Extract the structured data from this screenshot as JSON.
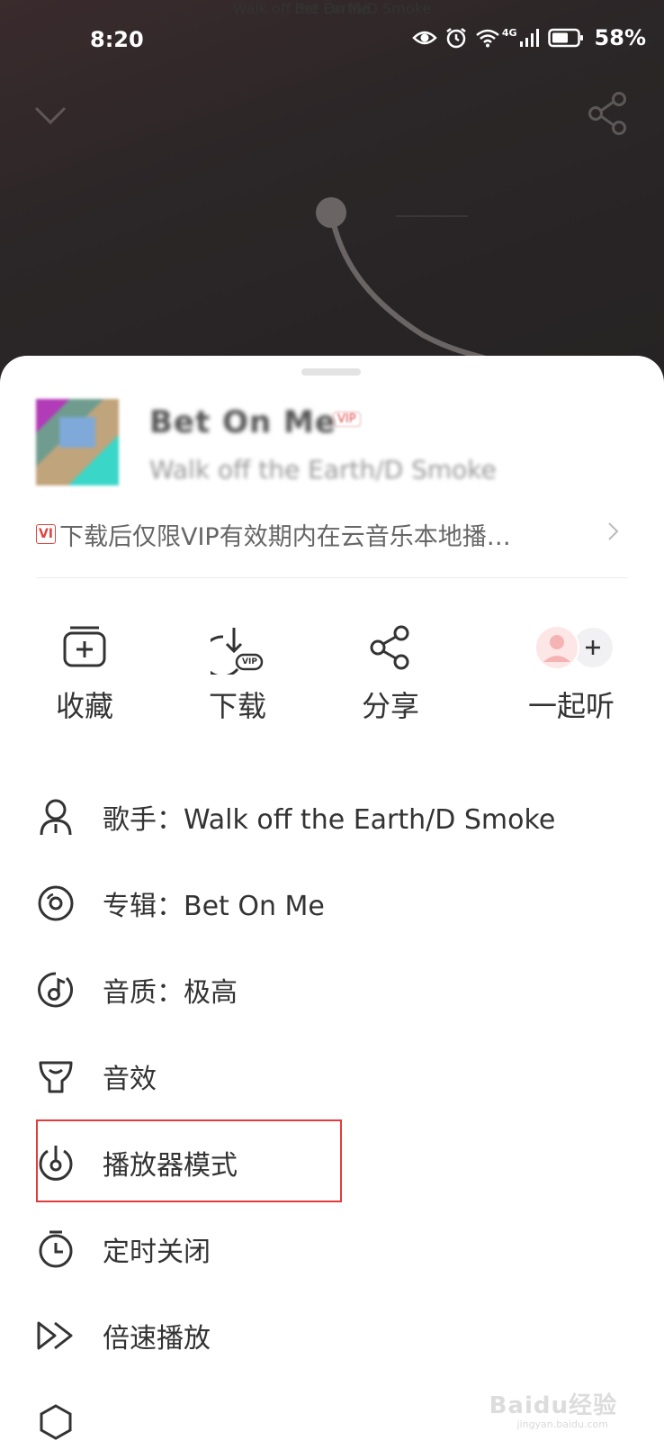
{
  "status_bar": {
    "time": "8:20",
    "network": "4G",
    "battery": "58%",
    "icons": [
      "eye-icon",
      "alarm-icon",
      "wifi-icon",
      "signal-icon",
      "battery-icon"
    ]
  },
  "player": {
    "song_title": "Bet On Me",
    "artist_line": "Walk off the Earth/D Smoke",
    "icons": [
      "chevron-down-icon",
      "share-icon"
    ]
  },
  "sheet": {
    "song_title": "Bet On Me",
    "vip_badge": "VIP",
    "artist": "Walk off the Earth/D Smoke",
    "notice_tag": "VI",
    "notice": "下载后仅限VIP有效期内在云音乐本地播…",
    "actions": [
      {
        "label": "收藏",
        "icon": "collect-icon"
      },
      {
        "label": "下载",
        "icon": "download-vip-icon"
      },
      {
        "label": "分享",
        "icon": "share-icon"
      },
      {
        "label": "一起听",
        "icon": "listen-together-icon"
      }
    ],
    "download_vip_tag": "VIP",
    "menu": [
      {
        "label": "歌手：Walk off the Earth/D Smoke",
        "icon": "singer-icon"
      },
      {
        "label": "专辑：Bet On Me",
        "icon": "album-icon"
      },
      {
        "label": "音质：极高",
        "icon": "quality-icon"
      },
      {
        "label": "音效",
        "icon": "sound-effect-icon"
      },
      {
        "label": "播放器模式",
        "icon": "player-mode-icon"
      },
      {
        "label": "定时关闭",
        "icon": "timer-icon"
      },
      {
        "label": "倍速播放",
        "icon": "speed-icon"
      }
    ],
    "highlight_color": "#e23b3b"
  },
  "watermark": {
    "brand": "Baidu经验",
    "url": "jingyan.baidu.com"
  }
}
